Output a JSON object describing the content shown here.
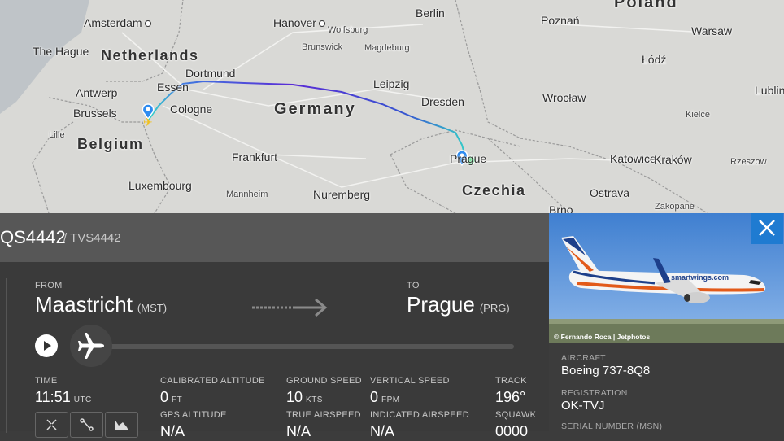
{
  "map": {
    "cities": [
      {
        "name": "Amsterdam"
      },
      {
        "name": "The Hague"
      },
      {
        "name": "Netherlands"
      },
      {
        "name": "Antwerp"
      },
      {
        "name": "Brussels"
      },
      {
        "name": "Belgium"
      },
      {
        "name": "Lille"
      },
      {
        "name": "Luxembourg"
      },
      {
        "name": "Essen"
      },
      {
        "name": "Dortmund"
      },
      {
        "name": "Cologne"
      },
      {
        "name": "Hanover"
      },
      {
        "name": "Wolfsburg"
      },
      {
        "name": "Brunswick"
      },
      {
        "name": "Magdeburg"
      },
      {
        "name": "Berlin"
      },
      {
        "name": "Germany"
      },
      {
        "name": "Leipzig"
      },
      {
        "name": "Dresden"
      },
      {
        "name": "Frankfurt"
      },
      {
        "name": "Mannheim"
      },
      {
        "name": "Nuremberg"
      },
      {
        "name": "Prague"
      },
      {
        "name": "Czechia"
      },
      {
        "name": "Poland"
      },
      {
        "name": "Poznań"
      },
      {
        "name": "Warsaw"
      },
      {
        "name": "Łódź"
      },
      {
        "name": "Wrocław"
      },
      {
        "name": "Lublin"
      },
      {
        "name": "Kielce"
      },
      {
        "name": "Katowice"
      },
      {
        "name": "Kraków"
      },
      {
        "name": "Rzeszow"
      },
      {
        "name": "Ostrava"
      },
      {
        "name": "Brno"
      },
      {
        "name": "Zakopane"
      }
    ]
  },
  "flight": {
    "callsign": "QS4442",
    "alt_callsign": "/ TVS4442",
    "from_label": "FROM",
    "from_city": "Maastricht",
    "from_code": "(MST)",
    "to_label": "TO",
    "to_city": "Prague",
    "to_code": "(PRG)",
    "progress": 0
  },
  "stats": {
    "time_label": "TIME",
    "time_value": "11:51",
    "time_unit": "UTC",
    "cal_alt_label": "CALIBRATED ALTITUDE",
    "cal_alt_value": "0",
    "cal_alt_unit": "FT",
    "gps_alt_label": "GPS ALTITUDE",
    "gps_alt_value": "N/A",
    "ground_speed_label": "GROUND SPEED",
    "ground_speed_value": "10",
    "ground_speed_unit": "KTS",
    "true_airspeed_label": "TRUE AIRSPEED",
    "true_airspeed_value": "N/A",
    "vertical_speed_label": "VERTICAL SPEED",
    "vertical_speed_value": "0",
    "vertical_speed_unit": "FPM",
    "indicated_airspeed_label": "INDICATED AIRSPEED",
    "indicated_airspeed_value": "N/A",
    "track_label": "TRACK",
    "track_value": "196°",
    "squawk_label": "SQUAWK",
    "squawk_value": "0000"
  },
  "aircraft": {
    "photo_credit": "© Fernando Roca | Jetphotos",
    "livery_text": "smartwings.com",
    "aircraft_label": "AIRCRAFT",
    "aircraft_value": "Boeing 737-8Q8",
    "registration_label": "REGISTRATION",
    "registration_value": "OK-TVJ",
    "serial_label": "SERIAL NUMBER (MSN)"
  },
  "colors": {
    "close_button": "#1f7bd1",
    "route_start": "#35d6c8",
    "route_mid": "#5a2bd6",
    "route_end": "#3fa8e8"
  },
  "icons": [
    "close-icon",
    "play-icon",
    "airplane-icon",
    "expand-icon",
    "route-icon",
    "chart-icon",
    "map-pin-icon"
  ]
}
